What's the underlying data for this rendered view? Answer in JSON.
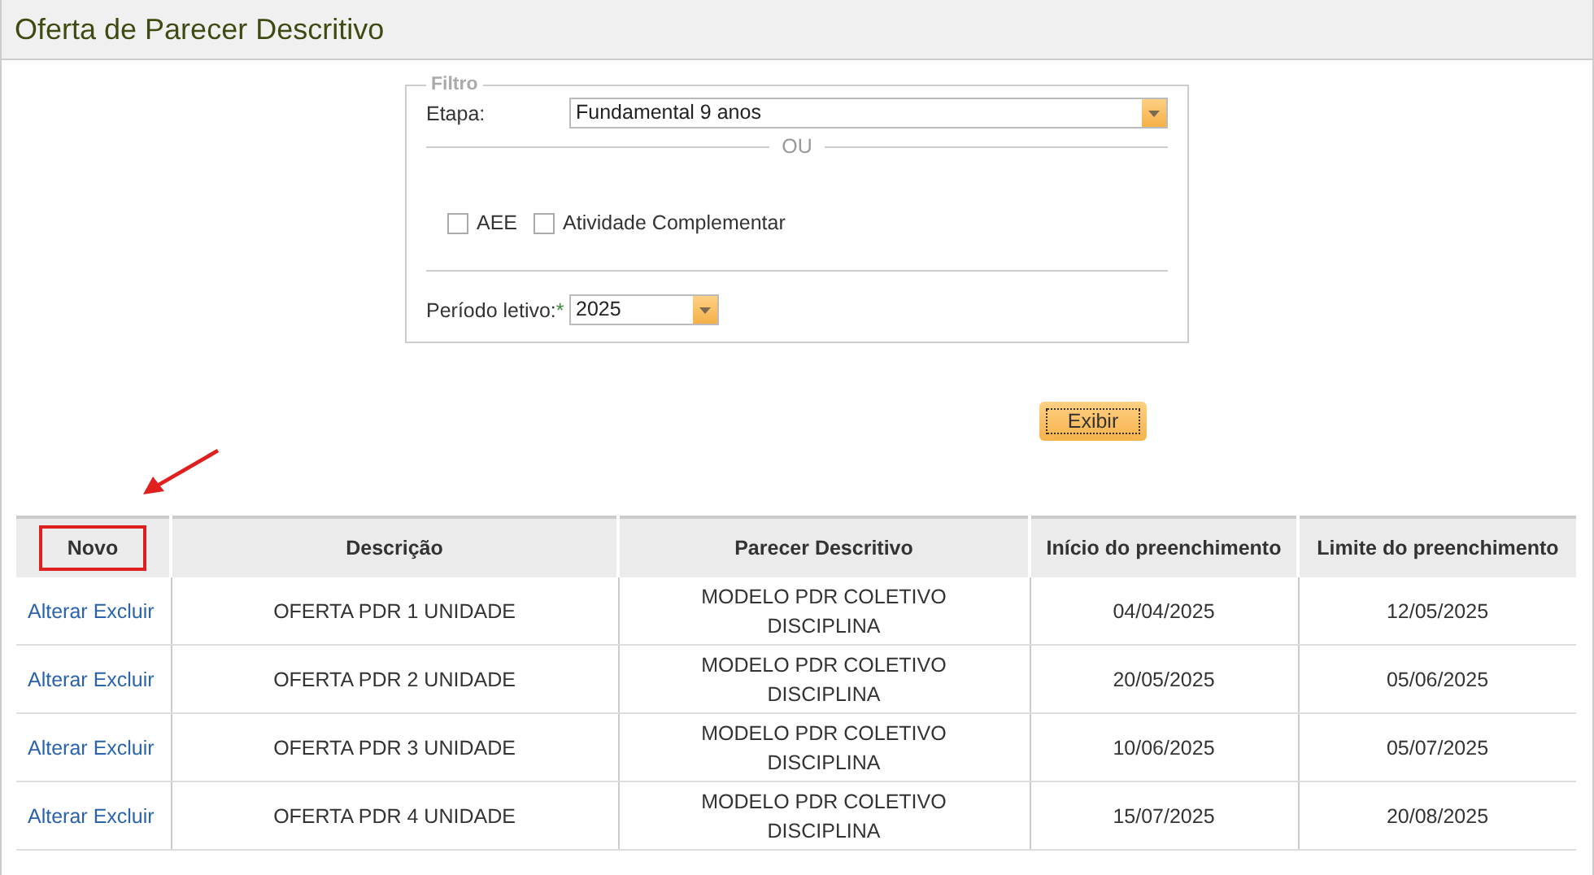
{
  "page": {
    "title": "Oferta de Parecer Descritivo"
  },
  "filter": {
    "legend": "Filtro",
    "etapa_label": "Etapa:",
    "etapa_value": "Fundamental 9 anos",
    "separator": "OU",
    "checkboxes": [
      {
        "label": "AEE",
        "checked": false
      },
      {
        "label": "Atividade Complementar",
        "checked": false
      }
    ],
    "periodo_label": "Período letivo:",
    "required_mark": "*",
    "periodo_value": "2025"
  },
  "show_button": "Exibir",
  "table": {
    "new_button": "Novo",
    "columns": [
      "Descrição",
      "Parecer Descritivo",
      "Início do preenchimento",
      "Limite do preenchimento"
    ],
    "rows": [
      {
        "actions": [
          "Alterar",
          "Excluir"
        ],
        "cells": [
          "OFERTA PDR 1 UNIDADE",
          "MODELO PDR COLETIVO DISCIPLINA",
          "04/04/2025",
          "12/05/2025"
        ]
      },
      {
        "actions": [
          "Alterar",
          "Excluir"
        ],
        "cells": [
          "OFERTA PDR 2 UNIDADE",
          "MODELO PDR COLETIVO DISCIPLINA",
          "20/05/2025",
          "05/06/2025"
        ]
      },
      {
        "actions": [
          "Alterar",
          "Excluir"
        ],
        "cells": [
          "OFERTA PDR 3 UNIDADE",
          "MODELO PDR COLETIVO DISCIPLINA",
          "10/06/2025",
          "05/07/2025"
        ]
      },
      {
        "actions": [
          "Alterar",
          "Excluir"
        ],
        "cells": [
          "OFERTA PDR 4 UNIDADE",
          "MODELO PDR COLETIVO DISCIPLINA",
          "15/07/2025",
          "20/08/2025"
        ]
      }
    ]
  }
}
